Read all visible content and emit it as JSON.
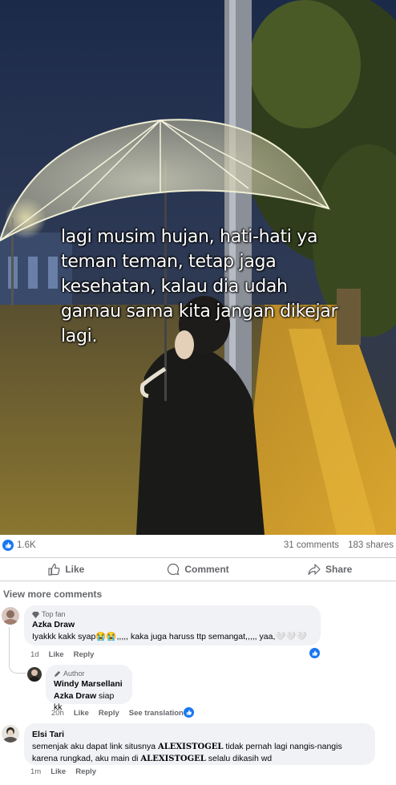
{
  "post": {
    "caption": "lagi musim hujan, hati-hati ya teman teman, tetap jaga kesehatan, kalau dia udah gamau sama kita jangan dikejar lagi.",
    "reactions_count": "1.6K",
    "comments_count": "31 comments",
    "shares_count": "183 shares"
  },
  "actions": {
    "like": "Like",
    "comment": "Comment",
    "share": "Share"
  },
  "view_more": "View more comments",
  "comments": [
    {
      "badge": "Top fan",
      "author": "Azka Draw",
      "text": "Iyakkk kakk syap😭😭,,,,, kaka juga haruss ttp semangat,,,,, yaa,🤍🤍🤍",
      "time": "1d",
      "like": "Like",
      "reply": "Reply"
    },
    {
      "badge": "Author",
      "author": "Windy Marsellani",
      "mention": "Azka Draw",
      "text": "siap kk",
      "time": "20h",
      "like": "Like",
      "reply": "Reply",
      "translate": "See translation"
    },
    {
      "author": "Elsi Tari",
      "text_1": "semenjak aku dapat link situsnya",
      "brand": "ALEXISTOGEL",
      "text_2": "tidak pernah lagi nangis-nangis karena rungkad, aku main di",
      "text_3": "selalu dikasih wd",
      "time": "1m",
      "like": "Like",
      "reply": "Reply"
    }
  ],
  "colors": {
    "accent": "#1877f2",
    "bubble": "#f0f2f5",
    "muted": "#65676b"
  }
}
